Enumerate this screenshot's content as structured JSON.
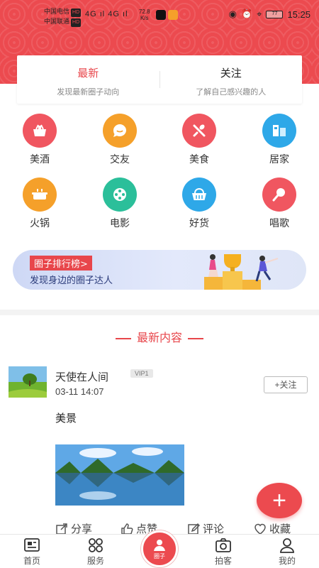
{
  "status_bar": {
    "carrier1": "中国电信",
    "carrier2": "中国联通",
    "hd": "HD",
    "network": "4G ıl 4G ıl",
    "speed": "72.8",
    "speed_unit": "K/s",
    "battery": "77",
    "time": "15:25"
  },
  "tabs": [
    {
      "title": "最新",
      "subtitle": "发现最新圈子动向",
      "active": true
    },
    {
      "title": "关注",
      "subtitle": "了解自己感兴趣的人",
      "active": false
    }
  ],
  "categories": [
    {
      "label": "美酒",
      "icon": "wine-basket-icon",
      "color": "#f05660"
    },
    {
      "label": "交友",
      "icon": "chat-bubble-icon",
      "color": "#f5a02a"
    },
    {
      "label": "美食",
      "icon": "fork-spoon-icon",
      "color": "#f05660"
    },
    {
      "label": "居家",
      "icon": "home-furniture-icon",
      "color": "#2ea8e8"
    },
    {
      "label": "火锅",
      "icon": "hotpot-icon",
      "color": "#f5a02a"
    },
    {
      "label": "电影",
      "icon": "film-reel-icon",
      "color": "#2bbf9a"
    },
    {
      "label": "好货",
      "icon": "shopping-basket-icon",
      "color": "#2ea8e8"
    },
    {
      "label": "唱歌",
      "icon": "microphone-icon",
      "color": "#f05660"
    }
  ],
  "banner": {
    "badge": "圈子排行榜>",
    "subtitle": "发现身边的圈子达人"
  },
  "feed": {
    "section_title": "最新内容",
    "post": {
      "username": "天使在人间",
      "vip": "VIP1",
      "time": "03-11 14:07",
      "follow_label": "+关注",
      "text": "美景"
    },
    "actions": {
      "share": "分享",
      "like": "点赞",
      "comment": "评论",
      "favorite": "收藏"
    }
  },
  "fab_label": "+",
  "bottom_nav": {
    "home": "首页",
    "service": "服务",
    "circle": "圈子",
    "photo": "拍客",
    "mine": "我的"
  },
  "colors": {
    "brand_red": "#ec4a4f"
  }
}
